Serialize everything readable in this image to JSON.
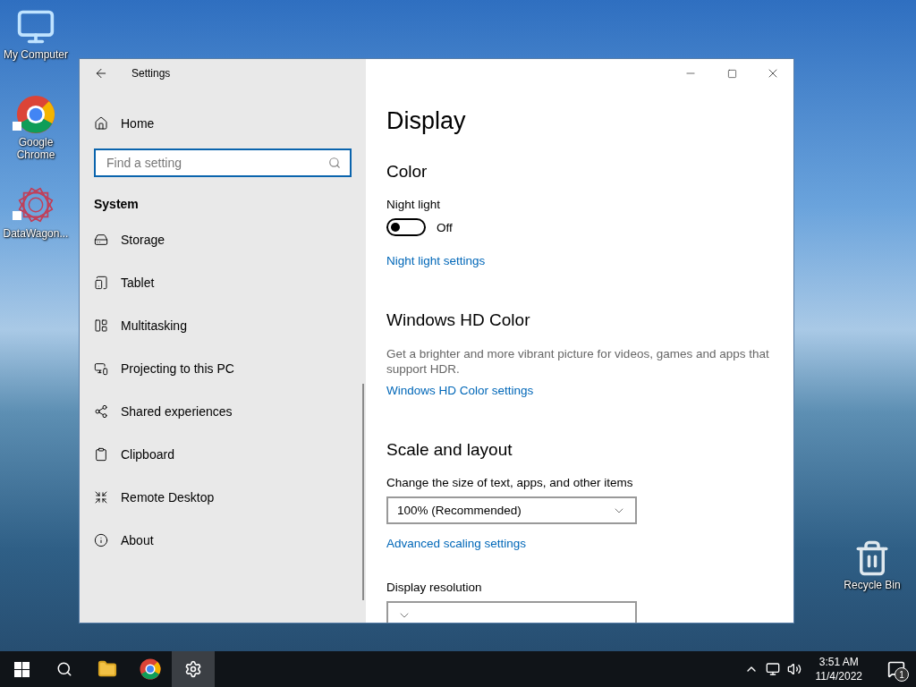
{
  "desktop_icons": [
    {
      "kind": "computer",
      "label": "My Computer"
    },
    {
      "kind": "chrome",
      "label": "Google Chrome",
      "shortcut": true
    },
    {
      "kind": "star",
      "label": "DataWagon...",
      "shortcut": true
    }
  ],
  "recycle_bin": {
    "label": "Recycle Bin"
  },
  "window": {
    "title": "Settings"
  },
  "sidebar": {
    "home": "Home",
    "search": {
      "placeholder": "Find a setting"
    },
    "section": "System",
    "items": [
      {
        "kind": "storage",
        "label": "Storage"
      },
      {
        "kind": "tablet",
        "label": "Tablet"
      },
      {
        "kind": "multitasking",
        "label": "Multitasking"
      },
      {
        "kind": "projecting",
        "label": "Projecting to this PC"
      },
      {
        "kind": "shared",
        "label": "Shared experiences"
      },
      {
        "kind": "clipboard",
        "label": "Clipboard"
      },
      {
        "kind": "remote",
        "label": "Remote Desktop"
      },
      {
        "kind": "about",
        "label": "About"
      }
    ]
  },
  "content": {
    "title": "Display",
    "blocks": [
      {
        "kind": "heading",
        "text": "Color"
      },
      {
        "kind": "label",
        "text": "Night light"
      },
      {
        "kind": "toggle",
        "on": false,
        "text": "Off"
      },
      {
        "kind": "link",
        "text": "Night light settings"
      },
      {
        "kind": "heading",
        "text": "Windows HD Color"
      },
      {
        "kind": "paragraph",
        "text": "Get a brighter and more vibrant picture for videos, games and apps that support HDR."
      },
      {
        "kind": "link",
        "text": "Windows HD Color settings"
      },
      {
        "kind": "heading",
        "text": "Scale and layout"
      },
      {
        "kind": "label",
        "text": "Change the size of text, apps, and other items"
      },
      {
        "kind": "dropdown",
        "text": "100% (Recommended)"
      },
      {
        "kind": "link",
        "text": "Advanced scaling settings"
      },
      {
        "kind": "label",
        "text": "Display resolution"
      },
      {
        "kind": "dropdown"
      }
    ]
  },
  "taskbar": {
    "apps": [
      {
        "kind": "start"
      },
      {
        "kind": "search"
      },
      {
        "kind": "folder"
      },
      {
        "kind": "chrome"
      },
      {
        "kind": "settings",
        "selected": true
      }
    ],
    "time": "3:51 AM",
    "date": "11/4/2022",
    "notifications": "1"
  }
}
